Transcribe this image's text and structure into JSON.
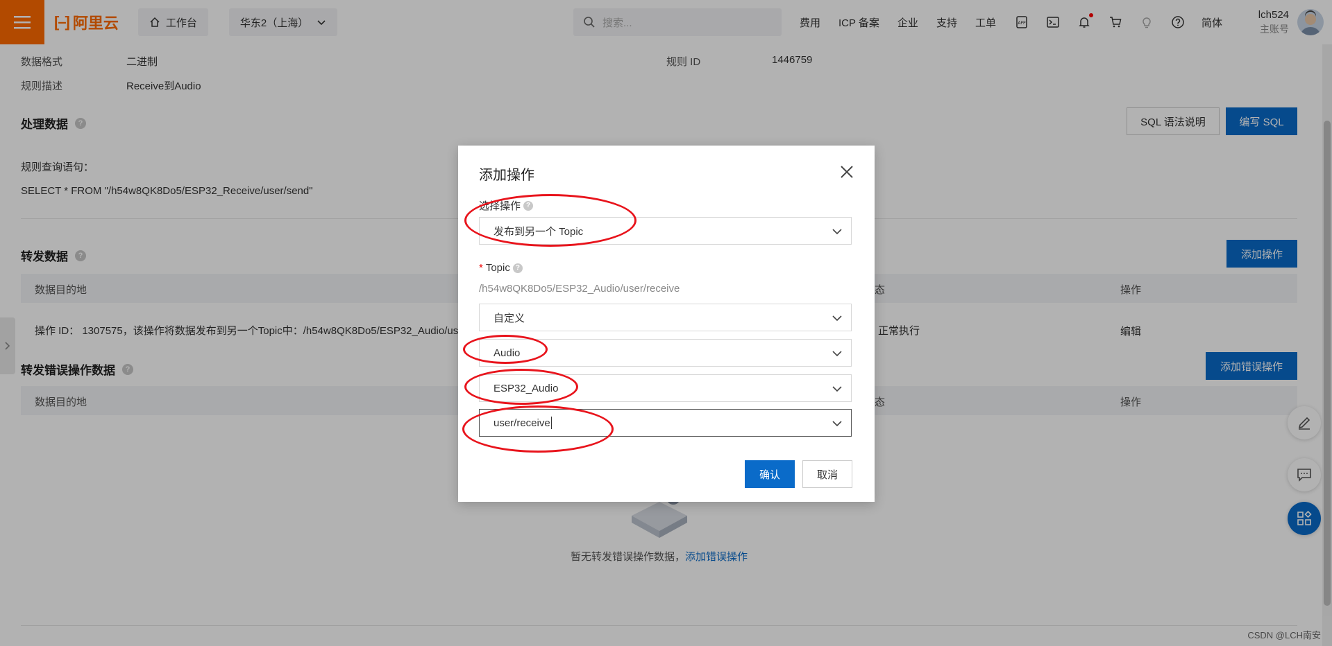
{
  "topbar": {
    "logo_text": "阿里云",
    "workbench_label": "工作台",
    "region_label": "华东2（上海）",
    "search_placeholder": "搜索...",
    "links": [
      "费用",
      "ICP 备案",
      "企业",
      "支持",
      "工单"
    ],
    "lang_label": "简体",
    "account_name": "lch524",
    "account_sub": "主账号"
  },
  "rule_info": {
    "data_format_label": "数据格式",
    "data_format_value": "二进制",
    "rule_id_label": "规则 ID",
    "rule_id_value": "1446759",
    "desc_label": "规则描述",
    "desc_value": "Receive到Audio"
  },
  "process_section": {
    "title": "处理数据",
    "sql_help_button": "SQL 语法说明",
    "write_sql_button": "编写 SQL",
    "query_label": "规则查询语句：",
    "query_value": "SELECT * FROM \"/h54w8QK8Do5/ESP32_Receive/user/send\""
  },
  "forward_section": {
    "title": "转发数据",
    "add_button": "添加操作",
    "columns": [
      "数据目的地",
      "态",
      "操作"
    ],
    "row_desc": "操作 ID： 1307575，该操作将数据发布到另一个Topic中：/h54w8QK8Do5/ESP32_Audio/use",
    "row_status": "正常执行",
    "row_action": "编辑"
  },
  "error_section": {
    "title": "转发错误操作数据",
    "add_button": "添加错误操作",
    "columns": [
      "数据目的地",
      "态",
      "操作"
    ],
    "empty_text": "暂无转发错误操作数据，",
    "empty_link": "添加错误操作"
  },
  "watermark": "CSDN @LCH南安",
  "modal": {
    "title": "添加操作",
    "select_action_label": "选择操作",
    "select_action_value": "发布到另一个 Topic",
    "topic_label": "Topic",
    "topic_preview": "/h54w8QK8Do5/ESP32_Audio/user/receive",
    "topic_type_value": "自定义",
    "product_value": "Audio",
    "device_value": "ESP32_Audio",
    "topic_path_value": "user/receive",
    "confirm_button": "确认",
    "cancel_button": "取消"
  },
  "colors": {
    "brand_orange": "#ff6a00",
    "primary_blue": "#0a6bc9",
    "annotation_red": "#e8141c"
  }
}
